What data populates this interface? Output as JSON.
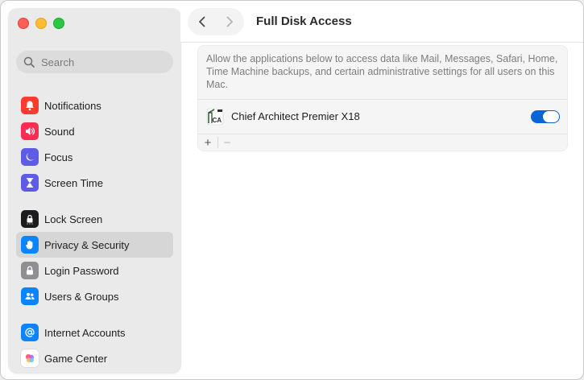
{
  "window": {
    "title": "Full Disk Access"
  },
  "sidebar": {
    "search_placeholder": "Search",
    "items": [
      {
        "label": "Notifications",
        "icon": "bell-icon",
        "color": "#ff3b30"
      },
      {
        "label": "Sound",
        "icon": "speaker-icon",
        "color": "#ff2d55"
      },
      {
        "label": "Focus",
        "icon": "moon-icon",
        "color": "#5e5ce6"
      },
      {
        "label": "Screen Time",
        "icon": "hourglass-icon",
        "color": "#5e5ce6"
      },
      {
        "label": "Lock Screen",
        "icon": "lock-screen-icon",
        "color": "#1c1c1e"
      },
      {
        "label": "Privacy & Security",
        "icon": "hand-icon",
        "color": "#0a84ff"
      },
      {
        "label": "Login Password",
        "icon": "lock-icon",
        "color": "#8e8e93"
      },
      {
        "label": "Users & Groups",
        "icon": "users-icon",
        "color": "#0a84ff"
      },
      {
        "label": "Internet Accounts",
        "icon": "at-icon",
        "color": "#0a84ff"
      },
      {
        "label": "Game Center",
        "icon": "game-center-icon",
        "color": "#ffffff"
      }
    ],
    "selected_index": 5
  },
  "content": {
    "description": "Allow the applications below to access data like Mail, Messages, Safari, Home, Time Machine backups, and certain administrative settings for all users on this Mac.",
    "apps": [
      {
        "name": "Chief Architect Premier X18",
        "enabled": true,
        "icon": "chief-architect-icon"
      }
    ],
    "add_label": "+",
    "remove_label": "−"
  },
  "colors": {
    "accent": "#0a64d6"
  }
}
